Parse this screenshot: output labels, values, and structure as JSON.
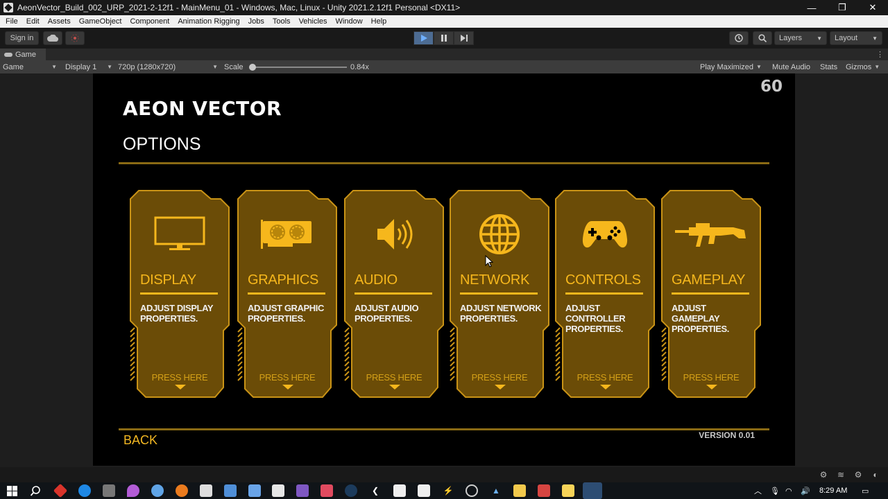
{
  "window": {
    "title": "AeonVector_Build_002_URP_2021-2-12f1 - MainMenu_01 - Windows, Mac, Linux - Unity 2021.2.12f1 Personal <DX11>",
    "minimize": "—",
    "maximize": "❐",
    "close": "✕"
  },
  "menubar": [
    "File",
    "Edit",
    "Assets",
    "GameObject",
    "Component",
    "Animation Rigging",
    "Jobs",
    "Tools",
    "Vehicles",
    "Window",
    "Help"
  ],
  "toolbar": {
    "sign_in": "Sign in",
    "layers": "Layers",
    "layout": "Layout"
  },
  "tab": {
    "label": "Game"
  },
  "gamebar": {
    "view": "Game",
    "display": "Display 1",
    "resolution": "720p (1280x720)",
    "scale_label": "Scale",
    "scale_value": "0.84x",
    "play_maximized": "Play Maximized",
    "mute_audio": "Mute Audio",
    "stats": "Stats",
    "gizmos": "Gizmos"
  },
  "game": {
    "fps": "60",
    "title": "AEON VECTOR",
    "page_title": "OPTIONS",
    "back": "BACK",
    "version": "VERSION 0.01",
    "accent_color": "#f6b71c",
    "cards": [
      {
        "name": "DISPLAY",
        "desc": "ADJUST DISPLAY PROPERTIES.",
        "press": "PRESS HERE",
        "icon": "monitor-icon"
      },
      {
        "name": "GRAPHICS",
        "desc": "ADJUST GRAPHIC PROPERTIES.",
        "press": "PRESS HERE",
        "icon": "graphics-card-icon"
      },
      {
        "name": "AUDIO",
        "desc": "ADJUST AUDIO PROPERTIES.",
        "press": "PRESS HERE",
        "icon": "speaker-icon"
      },
      {
        "name": "NETWORK",
        "desc": "ADJUST NETWORK PROPERTIES.",
        "press": "PRESS HERE",
        "icon": "globe-icon"
      },
      {
        "name": "CONTROLS",
        "desc": "ADJUST CONTROLLER PROPERTIES.",
        "press": "PRESS HERE",
        "icon": "gamepad-icon"
      },
      {
        "name": "GAMEPLAY",
        "desc": "ADJUST GAMEPLAY PROPERTIES.",
        "press": "PRESS HERE",
        "icon": "rifle-icon"
      }
    ]
  },
  "taskbar": {
    "time": "8:29 AM"
  }
}
